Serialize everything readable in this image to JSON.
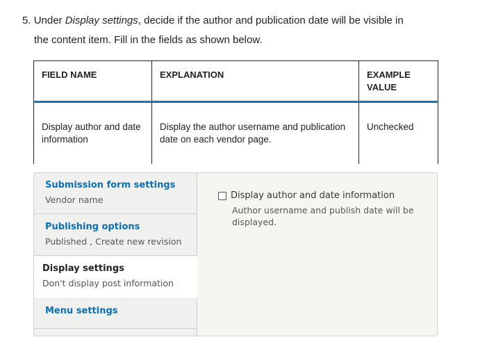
{
  "step": {
    "number": "5.",
    "prefix": "Under ",
    "emphasis": "Display settings",
    "suffix": ", decide if the author and publication date will be visible in",
    "line2": "the content item. Fill in the fields as shown below."
  },
  "table": {
    "headers": [
      "FIELD NAME",
      "EXPLANATION",
      "EXAMPLE VALUE"
    ],
    "rows": [
      {
        "field": "Display author and date information",
        "explanation": "Display the author username and publication date on each vendor page.",
        "example": "Unchecked"
      }
    ]
  },
  "vertical_tabs": [
    {
      "title": "Submission form settings",
      "summary": "Vendor name",
      "active": false
    },
    {
      "title": "Publishing options",
      "summary": "Published , Create new revision",
      "active": false
    },
    {
      "title": "Display settings",
      "summary": "Don't display post information",
      "active": true
    },
    {
      "title": "Menu settings",
      "summary": "",
      "active": false
    }
  ],
  "pane": {
    "checkbox_label": "Display author and date information",
    "checkbox_checked": false,
    "description": "Author username and publish date will be displayed."
  },
  "colors": {
    "link": "#0b6fb3",
    "header_rule": "#1d6fb8"
  }
}
